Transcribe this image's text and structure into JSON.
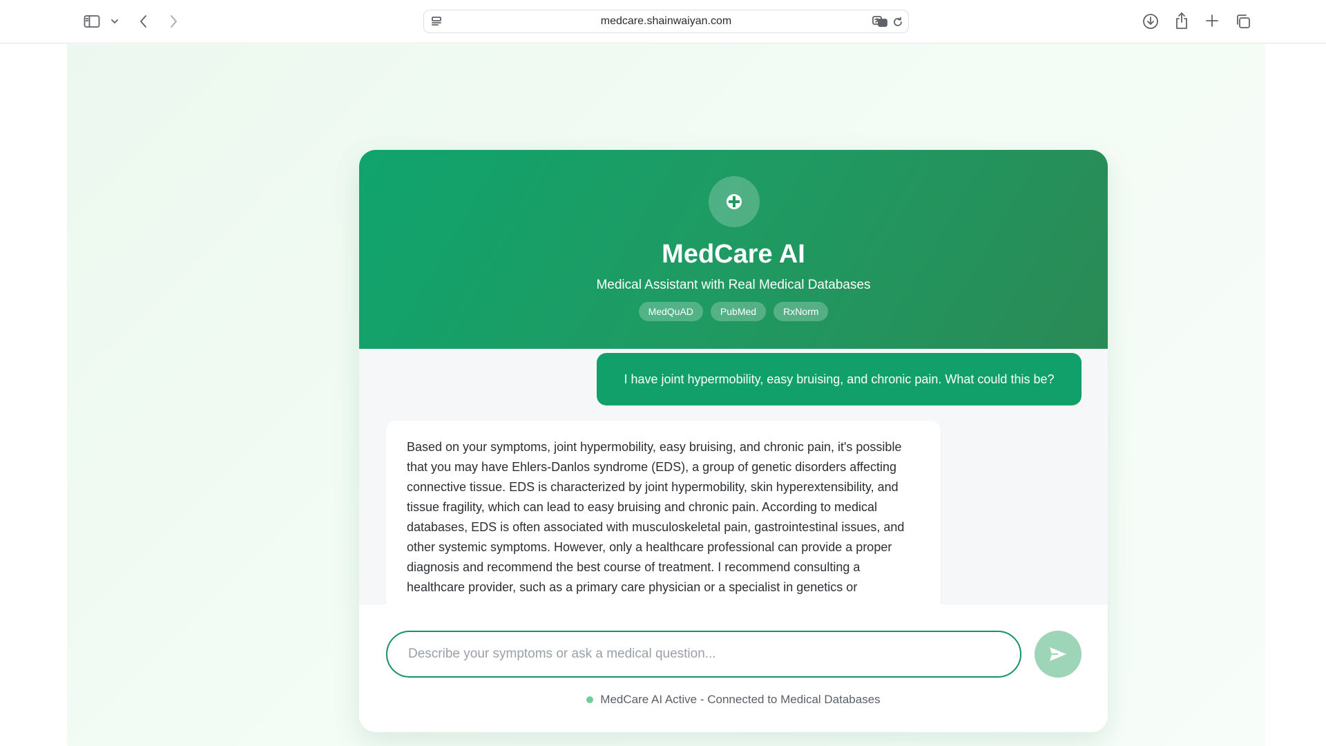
{
  "browser": {
    "url": "medcare.shainwaiyan.com",
    "icons": [
      "sidebar-icon",
      "chevron-down-icon",
      "back-icon",
      "forward-icon",
      "page-menu-icon",
      "translate-icon",
      "reload-icon",
      "download-icon",
      "share-icon",
      "new-tab-icon",
      "tabs-overview-icon"
    ]
  },
  "app": {
    "title": "MedCare AI",
    "subtitle": "Medical Assistant with Real Medical Databases",
    "badges": [
      "MedQuAD",
      "PubMed",
      "RxNorm"
    ],
    "logo_icon": "medical-cross-icon"
  },
  "chat": {
    "messages": [
      {
        "role": "user",
        "text": "I have joint hypermobility, easy bruising, and chronic pain. What could this be?"
      },
      {
        "role": "assistant",
        "text": "Based on your symptoms, joint hypermobility, easy bruising, and chronic pain, it's possible that you may have Ehlers-Danlos syndrome (EDS), a group of genetic disorders affecting connective tissue. EDS is characterized by joint hypermobility, skin hyperextensibility, and tissue fragility, which can lead to easy bruising and chronic pain. According to medical databases, EDS is often associated with musculoskeletal pain, gastrointestinal issues, and other systemic symptoms. However, only a healthcare professional can provide a proper diagnosis and recommend the best course of treatment. I recommend consulting a healthcare provider, such as a primary care physician or a specialist in genetics or"
      }
    ]
  },
  "input": {
    "placeholder": "Describe your symptoms or ask a medical question...",
    "value": "",
    "send_icon": "send-icon"
  },
  "status": {
    "text": "MedCare AI Active - Connected to Medical Databases"
  },
  "colors": {
    "primary": "#11a06a",
    "header_start": "#10a46d",
    "header_end": "#2a8a56",
    "send_button": "#9ed4b7",
    "status_dot": "#6fcf97"
  }
}
